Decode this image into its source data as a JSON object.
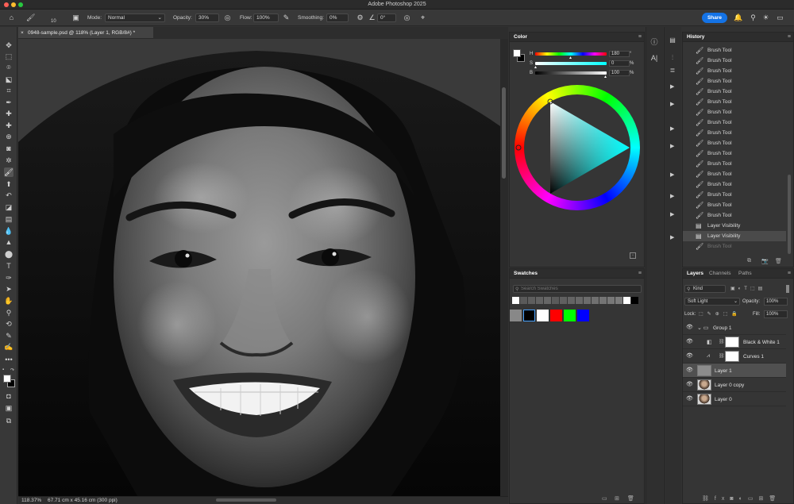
{
  "app": {
    "title": "Adobe Photoshop 2025"
  },
  "options_bar": {
    "brush_size": "10",
    "mode_label": "Mode:",
    "mode_value": "Normal",
    "opacity_label": "Opacity:",
    "opacity_value": "30%",
    "flow_label": "Flow:",
    "flow_value": "100%",
    "smoothing_label": "Smoothing:",
    "smoothing_value": "0%",
    "angle_value": "0°",
    "share_label": "Share"
  },
  "document": {
    "tab_title": "0948-sample.psd @ 118% (Layer 1, RGB/8#) *",
    "zoom": "118.37%",
    "size": "67.71 cm x 45.16 cm (300 ppi)"
  },
  "color_panel": {
    "tab": "Color",
    "h_label": "H",
    "h_value": "180",
    "h_unit": "°",
    "s_label": "S",
    "s_value": "0",
    "s_unit": "%",
    "b_label": "B",
    "b_value": "100",
    "b_unit": "%",
    "hue": 180,
    "saturation": 0,
    "brightness": 100
  },
  "swatches_panel": {
    "tab": "Swatches",
    "search_placeholder": "Search Swatches",
    "recent": [
      "#ffffff",
      "#5a5a5a",
      "#5e5e5e",
      "#626262",
      "#666666",
      "#5a5a5a",
      "#606060",
      "#646464",
      "#686868",
      "#6c6c6c",
      "#707070",
      "#747474",
      "#787878",
      "#7c7c7c",
      "#ffffff",
      "#000000"
    ],
    "basic": [
      "#888888",
      "#000000",
      "#ffffff",
      "#ff0000",
      "#00ff00",
      "#0000ff"
    ]
  },
  "history_panel": {
    "tab": "History",
    "items": [
      {
        "label": "Brush Tool",
        "icon": "brush-icon"
      },
      {
        "label": "Brush Tool",
        "icon": "brush-icon"
      },
      {
        "label": "Brush Tool",
        "icon": "brush-icon"
      },
      {
        "label": "Brush Tool",
        "icon": "brush-icon"
      },
      {
        "label": "Brush Tool",
        "icon": "brush-icon"
      },
      {
        "label": "Brush Tool",
        "icon": "brush-icon"
      },
      {
        "label": "Brush Tool",
        "icon": "brush-icon"
      },
      {
        "label": "Brush Tool",
        "icon": "brush-icon"
      },
      {
        "label": "Brush Tool",
        "icon": "brush-icon"
      },
      {
        "label": "Brush Tool",
        "icon": "brush-icon"
      },
      {
        "label": "Brush Tool",
        "icon": "brush-icon"
      },
      {
        "label": "Brush Tool",
        "icon": "brush-icon"
      },
      {
        "label": "Brush Tool",
        "icon": "brush-icon"
      },
      {
        "label": "Brush Tool",
        "icon": "brush-icon"
      },
      {
        "label": "Brush Tool",
        "icon": "brush-icon"
      },
      {
        "label": "Brush Tool",
        "icon": "brush-icon"
      },
      {
        "label": "Brush Tool",
        "icon": "brush-icon"
      },
      {
        "label": "Layer Visibility",
        "icon": "layer-visibility-icon"
      },
      {
        "label": "Layer Visibility",
        "icon": "layer-visibility-icon"
      },
      {
        "label": "Brush Tool",
        "icon": "brush-icon"
      }
    ]
  },
  "layers_panel": {
    "tabs": [
      "Layers",
      "Channels",
      "Paths"
    ],
    "filter_label": "Kind",
    "blend_mode": "Soft Light",
    "opacity_label": "Opacity:",
    "opacity_value": "100%",
    "lock_label": "Lock:",
    "fill_label": "Fill:",
    "fill_value": "100%",
    "layers": [
      {
        "name": "Group 1",
        "kind": "group"
      },
      {
        "name": "Black & White 1",
        "kind": "adjustment"
      },
      {
        "name": "Curves 1",
        "kind": "adjustment"
      },
      {
        "name": "Layer 1",
        "kind": "pixel"
      },
      {
        "name": "Layer 0 copy",
        "kind": "photo"
      },
      {
        "name": "Layer 0",
        "kind": "photo"
      }
    ]
  },
  "colors": {
    "accent": "#1473e6",
    "foreground": "#ffffff",
    "background": "#000000"
  }
}
